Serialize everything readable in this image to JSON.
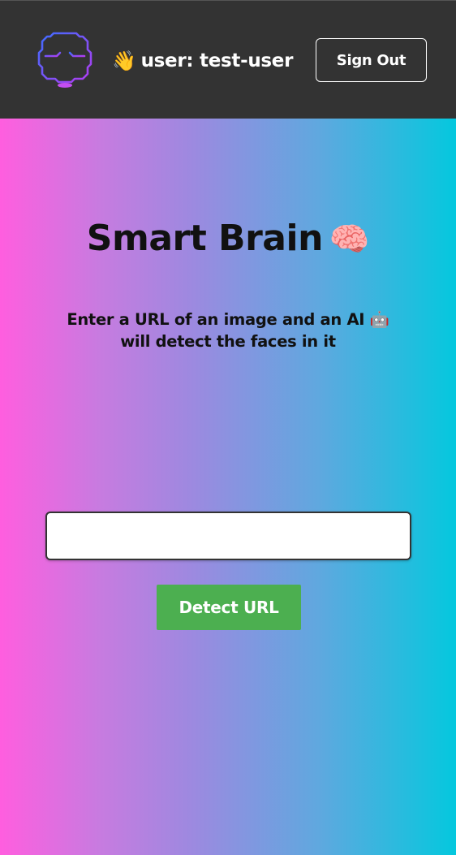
{
  "header": {
    "logo_icon": "brain-circuit-icon",
    "greeting_icon": "👋",
    "greeting_text": "user: test-user",
    "signout_label": "Sign Out"
  },
  "main": {
    "title": "Smart Brain",
    "title_icon": "🧠",
    "subtitle_line1": "Enter a URL of an image and an AI 🤖",
    "subtitle_line2": "will detect the faces in it",
    "url_input": {
      "value": "",
      "placeholder": ""
    },
    "detect_label": "Detect URL"
  },
  "colors": {
    "header_bg": "#333333",
    "gradient_start": "#ff5edf",
    "gradient_end": "#04c8de",
    "button_green": "#4caf50"
  }
}
